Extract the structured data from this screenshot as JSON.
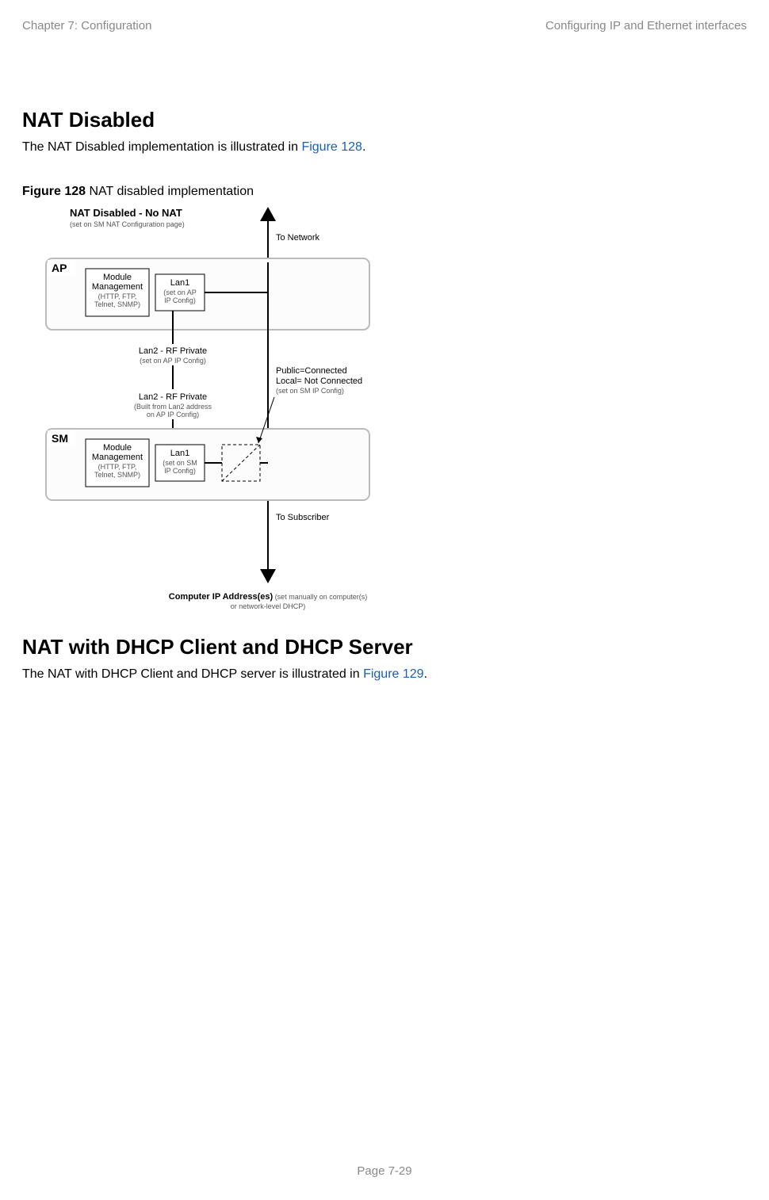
{
  "header": {
    "left": "Chapter 7:  Configuration",
    "right": "Configuring IP and Ethernet interfaces"
  },
  "section1": {
    "heading": "NAT Disabled",
    "body_pre": "The NAT Disabled implementation is illustrated in ",
    "body_link": "Figure 128",
    "body_post": "."
  },
  "figure": {
    "caption_bold": "Figure 128",
    "caption_rest": " NAT disabled implementation",
    "title_main": "NAT Disabled - No NAT",
    "title_sub": "(set on SM NAT Configuration page)",
    "to_network": "To Network",
    "to_subscriber": "To Subscriber",
    "ap_label": "AP",
    "sm_label": "SM",
    "module_mgmt": "Module",
    "module_mgmt2": "Management",
    "module_mgmt_sub1": "(HTTP, FTP,",
    "module_mgmt_sub2": "Telnet, SNMP)",
    "lan1": "Lan1",
    "lan1_ap_sub1": "(set on AP",
    "lan1_ap_sub2": "IP Config)",
    "lan1_sm_sub1": "(set on SM",
    "lan1_sm_sub2": "IP Config)",
    "lan2_rf1": "Lan2 - RF Private",
    "lan2_rf1_sub": "(set on AP IP Config)",
    "lan2_rf2": "Lan2 - RF Private",
    "lan2_rf2_sub1": "(Built from Lan2 address",
    "lan2_rf2_sub2": "on AP IP Config)",
    "public_line1": "Public=Connected",
    "public_line2": "Local= Not Connected",
    "public_line3": "(set on SM IP Config)",
    "comp_ip_bold": "Computer IP Address(es)",
    "comp_ip_rest1": " (set manually on computer(s)",
    "comp_ip_rest2": "or network-level DHCP)"
  },
  "section2": {
    "heading": "NAT with DHCP Client and DHCP Server",
    "body_pre": "The NAT with DHCP Client and DHCP server is illustrated in ",
    "body_link": "Figure 129",
    "body_post": "."
  },
  "footer": "Page 7-29"
}
